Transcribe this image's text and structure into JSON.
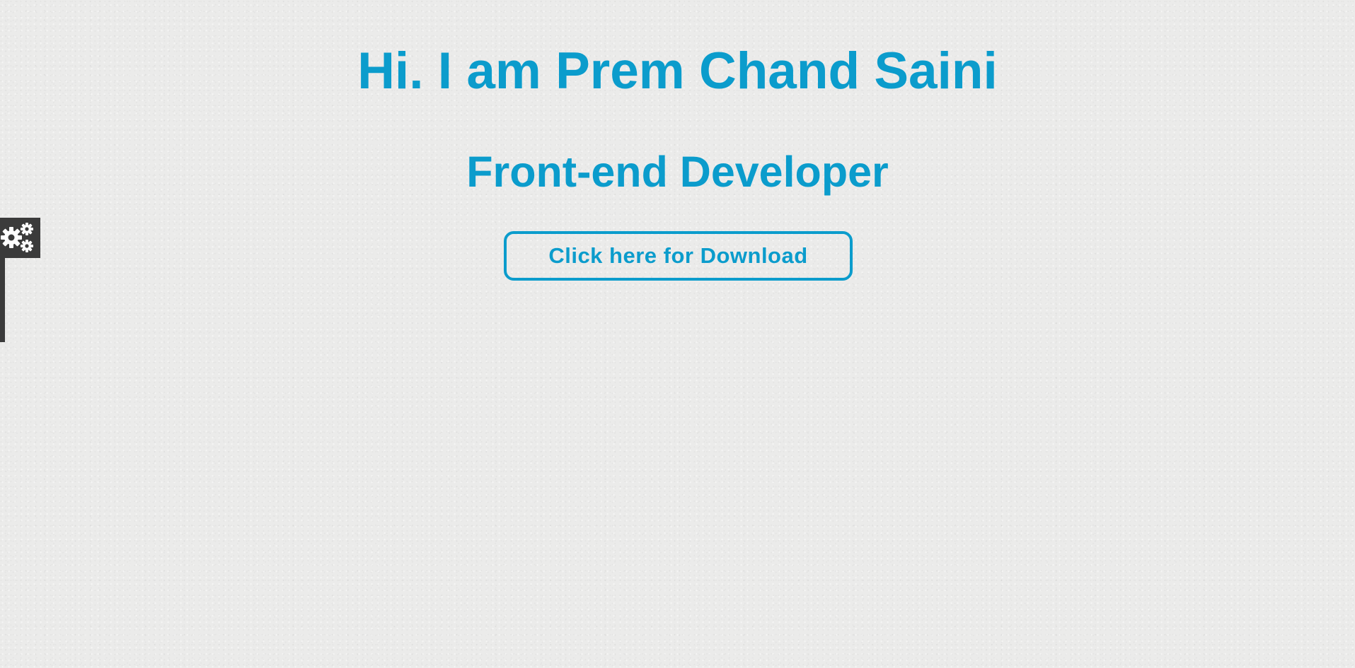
{
  "hero": {
    "title": "Hi. I am Prem Chand Saini",
    "subtitle": "Front-end Developer",
    "download_label": "Click here for Download"
  },
  "settings_panel": {
    "icon": "gears-icon"
  },
  "colors": {
    "accent": "#0b9ccc",
    "panel": "#3b3b3b",
    "background": "#ebebea"
  }
}
